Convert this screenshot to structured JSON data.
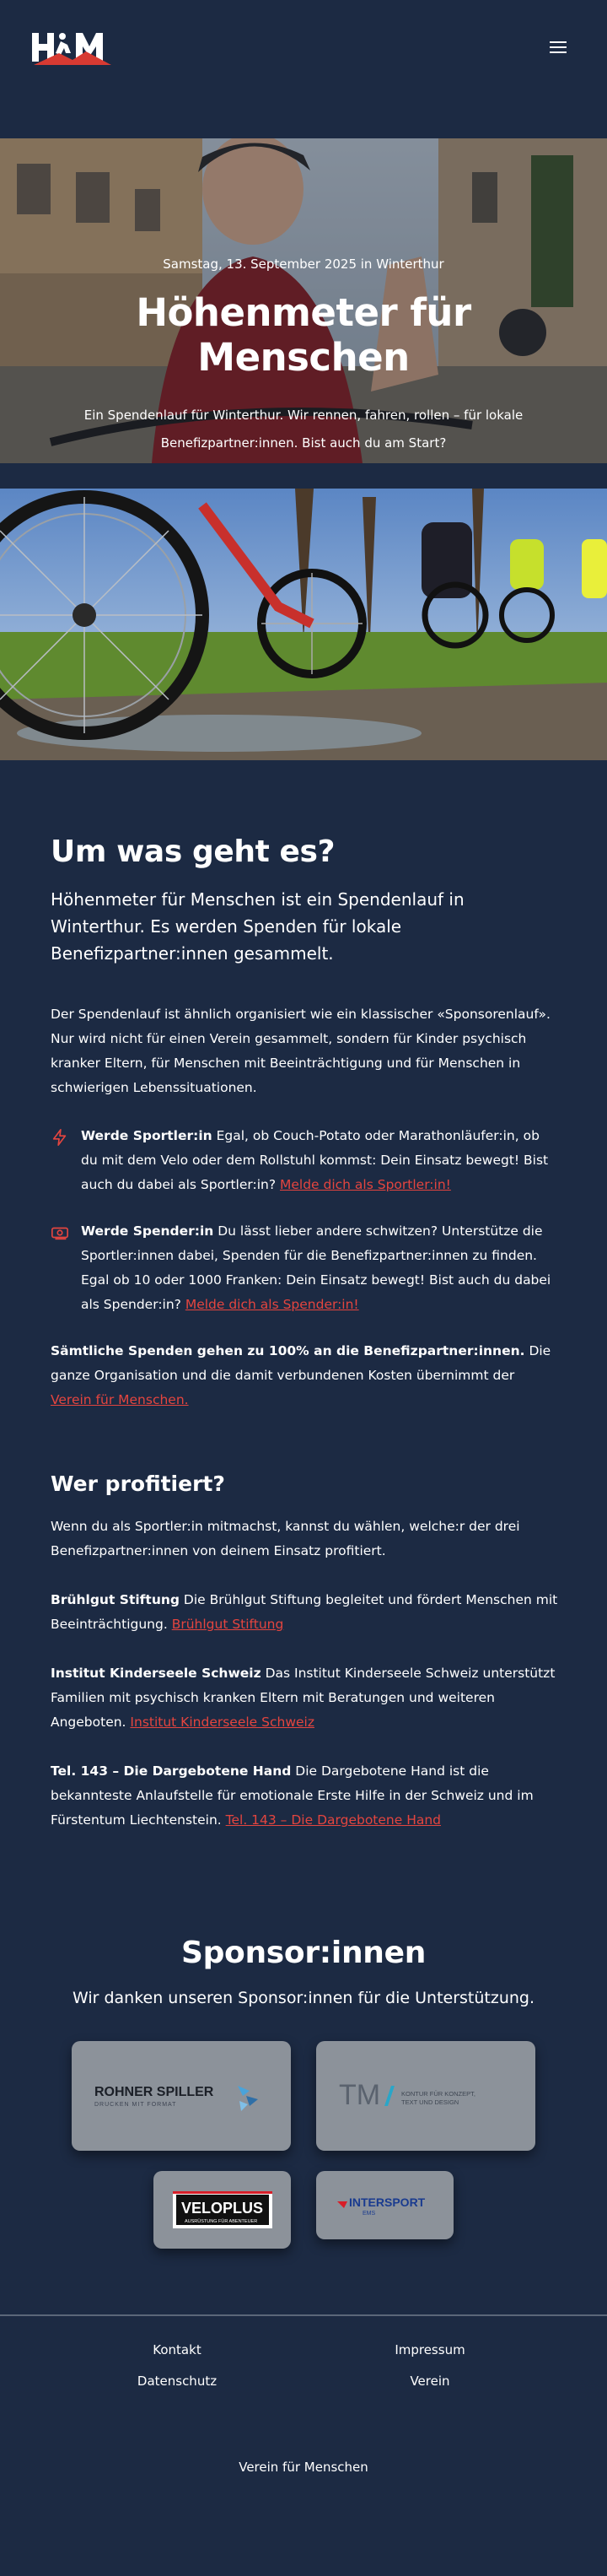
{
  "header": {
    "logo_text": "HfM",
    "menu_icon": "hamburger-menu-icon"
  },
  "hero": {
    "date": "Samstag, 13. September 2025 in Winterthur",
    "title": "Höhenmeter für Menschen",
    "text_line1": "Ein Spendenlauf für Winterthur. Wir rennen, fahren, rollen – für lokale",
    "text_line2": "Benefizpartner:innen. Bist auch du am Start?"
  },
  "about": {
    "heading": "Um was geht es?",
    "lead": "Höhenmeter für Menschen ist ein Spendenlauf in Winterthur. Es werden Spenden für lokale Benefizpartner:innen gesammelt.",
    "intro": "Der Spendenlauf ist ähnlich organisiert wie ein klassischer «Sponsorenlauf». Nur wird nicht für einen Verein gesammelt, sondern für Kinder psychisch kranker Eltern, für Menschen mit Beeinträchtigung und für Menschen in schwierigen Lebenssituationen.",
    "athlete": {
      "icon": "lightning-bolt-icon",
      "bold": "Werde Sportler:in",
      "text": " Egal, ob Couch-Potato oder Marathonläufer:in, ob du mit dem Velo oder dem Rollstuhl kommst: Dein Einsatz bewegt! Bist auch du dabei als Sportler:in? ",
      "link": "Melde dich als Sportler:in!"
    },
    "donor": {
      "icon": "money-bill-icon",
      "bold": "Werde Spender:in",
      "text": " Du lässt lieber andere schwitzen? Unterstütze die Sportler:innen dabei, Spenden für die Benefizpartner:innen zu finden. Egal ob 10 oder 1000 Franken: Dein Einsatz bewegt! Bist auch du dabei als Spender:in? ",
      "link": "Melde dich als Spender:in!"
    },
    "allin": {
      "bold": "Sämtliche Spenden gehen zu 100% an die Benefizpartner:innen.",
      "text": " Die ganze Organisation und die damit verbundenen Kosten übernimmt der ",
      "link": "Verein für Menschen."
    }
  },
  "beneficiaries": {
    "heading": "Wer profitiert?",
    "intro": "Wenn du als Sportler:in mitmachst, kannst du wählen, welche:r der drei Benefizpartner:innen von deinem Einsatz profitiert.",
    "items": [
      {
        "bold": "Brühlgut Stiftung",
        "text": " Die Brühlgut Stiftung begleitet und fördert Menschen mit Beeinträchtigung. ",
        "link": "Brühlgut Stiftung"
      },
      {
        "bold": "Institut Kinderseele Schweiz",
        "text": " Das Institut Kinderseele Schweiz unterstützt Familien mit psychisch kranken Eltern mit Beratungen und weiteren Angeboten. ",
        "link": "Institut Kinderseele Schweiz"
      },
      {
        "bold": "Tel. 143 – Die Dargebotene Hand",
        "text": " Die Dargebotene Hand ist die bekannteste Anlaufstelle für emotionale Erste Hilfe in der Schweiz und im Fürstentum Liechtenstein. ",
        "link": "Tel. 143 – Die Dargebotene Hand"
      }
    ]
  },
  "sponsors": {
    "heading": "Sponsor:innen",
    "subtitle": "Wir danken unseren Sponsor:innen für die Unterstützung.",
    "logos": {
      "rohner_name": "ROHNER SPILLER",
      "rohner_tag": "DRUCKEN MIT FORMAT",
      "tm_name": "TM",
      "tm_tag1": "KONTUR FÜR KONZEPT,",
      "tm_tag2": "TEXT UND DESIGN",
      "velo_name": "VELOPLUS",
      "velo_tag": "AUSRÜSTUNG FÜR ABENTEUER",
      "intersport_name": "INTERSPORT",
      "intersport_tag": "EMS"
    }
  },
  "footer": {
    "links_left": [
      "Kontakt",
      "Datenschutz"
    ],
    "links_right": [
      "Impressum",
      "Verein"
    ],
    "bottom": "Verein für Menschen"
  }
}
